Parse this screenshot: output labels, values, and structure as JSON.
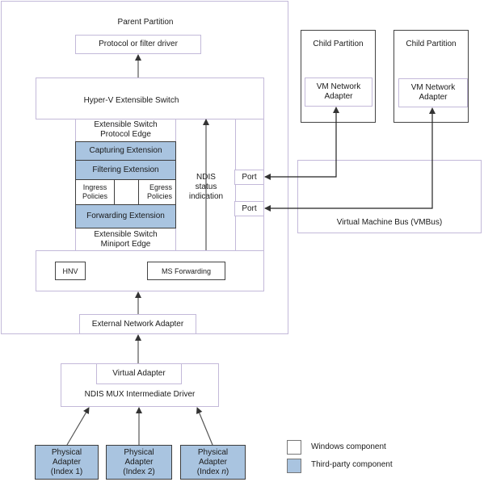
{
  "parent_partition": {
    "title": "Parent Partition",
    "protocol_driver": "Protocol or filter driver",
    "switch": {
      "title": "Hyper-V Extensible Switch",
      "protocol_edge": [
        "Extensible Switch",
        "Protocol Edge"
      ],
      "capturing": "Capturing Extension",
      "filtering": "Filtering Extension",
      "ingress": [
        "Ingress",
        "Policies"
      ],
      "egress": [
        "Egress",
        "Policies"
      ],
      "forwarding": "Forwarding Extension",
      "miniport_edge": [
        "Extensible Switch",
        "Miniport Edge"
      ],
      "ndis_status": [
        "NDIS",
        "status",
        "indication"
      ],
      "ports": [
        "Port",
        "Port"
      ],
      "hnv": "HNV",
      "ms_forwarding": "MS Forwarding"
    },
    "external_adapter": "External Network Adapter"
  },
  "child_partitions": [
    {
      "title": "Child Partition",
      "adapter": [
        "VM Network",
        "Adapter"
      ]
    },
    {
      "title": "Child Partition",
      "adapter": [
        "VM Network",
        "Adapter"
      ]
    }
  ],
  "vmbus": "Virtual Machine Bus (VMBus)",
  "mux": {
    "virtual_adapter": "Virtual Adapter",
    "title": "NDIS MUX Intermediate Driver"
  },
  "physical_adapters": [
    {
      "line1": "Physical",
      "line2": "Adapter",
      "index_prefix": "(Index ",
      "index": "1",
      "index_suffix": ")"
    },
    {
      "line1": "Physical",
      "line2": "Adapter",
      "index_prefix": "(Index ",
      "index": "2",
      "index_suffix": ")"
    },
    {
      "line1": "Physical",
      "line2": "Adapter",
      "index_prefix": "(Index ",
      "index": "n",
      "index_suffix": ")"
    }
  ],
  "legend": {
    "windows": "Windows component",
    "third_party": "Third-party component"
  },
  "colors": {
    "third_party_fill": "#a9c4e0",
    "windows_border": "#c3b9d9"
  }
}
